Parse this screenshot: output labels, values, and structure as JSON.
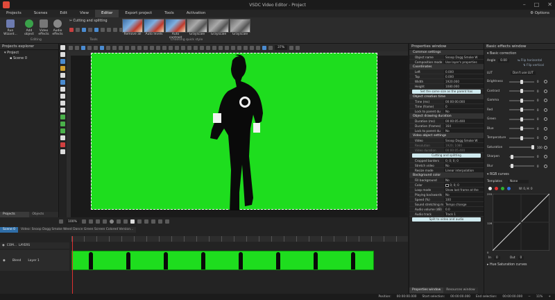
{
  "title": "VSDC Video Editor - Project",
  "window": {
    "min_icon": "minimize-icon",
    "max_icon": "maximize-icon",
    "close_icon": "close-icon"
  },
  "menu": {
    "items": [
      "Projects",
      "Scenes",
      "Edit",
      "View",
      "Editor",
      "Export project",
      "Tools",
      "Activation"
    ],
    "active_index": 4,
    "options_label": "Options"
  },
  "ribbon": {
    "run_wizard": "Run Wizard...",
    "add_object": "Add object",
    "video_effects": "Video effects",
    "audio_effects": "Audio effects",
    "editing_label": "Editing",
    "cutting_splitting": "Cutting and splitting",
    "tools_label": "Tools",
    "effects": [
      "Remove all",
      "Auto levels",
      "Auto contrast",
      "Grayscale",
      "Grayscale",
      "Grayscale"
    ],
    "quick_style_label": "Choosing quick style"
  },
  "projects_explorer": {
    "title": "Projects explorer",
    "items": [
      "Project",
      "Scene 0"
    ],
    "tabs": [
      "Projects explorer",
      "Objects explorer"
    ]
  },
  "canvas": {
    "zoom": "37%"
  },
  "timeline": {
    "tabs": [
      "Scene 0",
      "Video: Snoop Dogg Smoke Weed Dance Green Screen Colored Version..."
    ],
    "layer_blend": "COM...",
    "layer_label": "LAYERS",
    "track_name": "Blend",
    "track_layer": "Layer 1",
    "zoom_label": "100%"
  },
  "properties": {
    "title": "Properties window",
    "common_section": "Common settings",
    "object_name_k": "Object name",
    "object_name_v": "Snoop Dogg Smoke W",
    "comp_mode_k": "Composition mode",
    "comp_mode_v": "Use layer's properties",
    "coords_section": "Coordinates",
    "left_k": "Left",
    "left_v": "0.000",
    "top_k": "Top",
    "top_v": "0.000",
    "width_k": "Width",
    "width_v": "1920.000",
    "height_k": "Height",
    "height_v": "1080.000",
    "same_size_btn": "Set the same size as the parent has",
    "creation_section": "Object creation time",
    "time_ms_k": "Time (ms)",
    "time_ms_v": "00:00:00.000",
    "time_fr_k": "Time (frame)",
    "time_fr_v": "0",
    "lock_parent_k": "Lock to parent du",
    "lock_parent_v": "No",
    "duration_section": "Object drawing duration",
    "dur_ms_k": "Duration (ms)",
    "dur_ms_v": "00:00:05.400",
    "dur_fr_k": "Duration (frames)",
    "dur_fr_v": "164",
    "lock_parent2_k": "Lock to parent du",
    "lock_parent2_v": "No",
    "video_section": "Video object settings",
    "video_k": "Video",
    "video_v": "Snoop Dogg Smoke W",
    "resolution_k": "Resolution",
    "resolution_v": "1920; 1080",
    "video_dur_k": "Video duration",
    "video_dur_v": "00:00:05.400",
    "cutting_btn": "Cutting and splitting",
    "cropped_k": "Cropped borders",
    "cropped_v": "0; 0; 0; 0",
    "stretch_k": "Stretch video",
    "stretch_v": "No",
    "resize_k": "Resize mode",
    "resize_v": "Linear interpolation",
    "bg_section": "Background color",
    "fill_k": "Fill background",
    "fill_v": "No",
    "color_k": "Color",
    "color_v": "0; 0; 0",
    "loop_k": "Loop mode",
    "loop_v": "Show last frame at the",
    "playback_k": "Playing backwards",
    "playback_v": "No",
    "speed_k": "Speed (%)",
    "speed_v": "100",
    "sound_k": "Sound stretching m",
    "sound_v": "Tempo change",
    "audio_vol_k": "Audio volume (dB)",
    "audio_vol_v": "0.0",
    "audio_track_k": "Audio track",
    "audio_track_v": "Track 1",
    "split_btn": "Split to video and audio",
    "tabs": [
      "Properties window",
      "Resources window"
    ]
  },
  "effects_panel": {
    "title": "Basic effects window",
    "basic_correction": "Basic correction",
    "angle_k": "Angle",
    "angle_v": "0.00",
    "flip_h": "Flip horizontal",
    "flip_v": "Flip vertical",
    "lut_k": "LUT",
    "lut_v": "Don't use LUT",
    "sliders": [
      {
        "label": "Brightness",
        "value": "0",
        "pos": 0.5
      },
      {
        "label": "Contrast",
        "value": "0",
        "pos": 0.5
      },
      {
        "label": "Gamma",
        "value": "0",
        "pos": 0.5
      },
      {
        "label": "Red",
        "value": "0",
        "pos": 0.5
      },
      {
        "label": "Green",
        "value": "0",
        "pos": 0.5
      },
      {
        "label": "Blue",
        "value": "0",
        "pos": 0.5
      },
      {
        "label": "Temperature",
        "value": "0",
        "pos": 0.5
      },
      {
        "label": "Saturation",
        "value": "100",
        "pos": 1.0
      },
      {
        "label": "Sharpen",
        "value": "0",
        "pos": 0.05
      },
      {
        "label": "Blur",
        "value": "0",
        "pos": 0.05
      }
    ],
    "rgb_curves": "RGB curves",
    "templates_k": "Templates",
    "templates_v": "None",
    "in_k": "In",
    "in_v": "0",
    "out_k": "Out",
    "out_v": "0",
    "hue_sat": "Hue Saturation curves",
    "curve_top": "255",
    "curve_mid": "128",
    "curve_bottom": "0",
    "wh": "W: 0, H: 0"
  },
  "status": {
    "position_k": "Position:",
    "position_v": "00:00:00.000",
    "start_sel_k": "Start selection:",
    "start_sel_v": "00:00:00.000",
    "end_sel_k": "End selection:",
    "end_sel_v": "00:00:00.000",
    "zoom": "11%"
  }
}
